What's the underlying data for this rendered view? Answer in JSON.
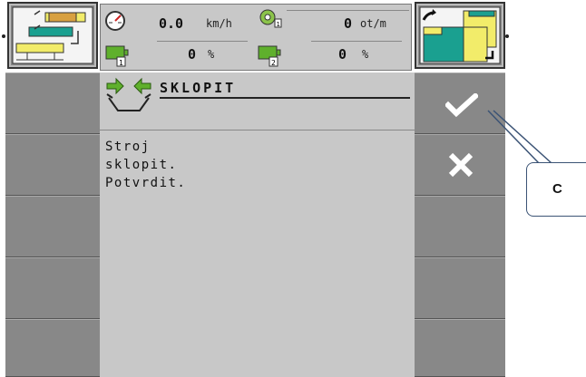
{
  "readouts": {
    "speed_value": "0.0",
    "speed_unit": "km/h",
    "rpm_value": "0",
    "rpm_unit": "ot/m",
    "pto1_value": "0",
    "pto1_unit": "%",
    "pto2_value": "0",
    "pto2_unit": "%"
  },
  "dialog": {
    "title": "SKLOPIT",
    "message": "Stroj\nsklopit.\nPotvrdit."
  },
  "softkeys": {
    "confirm_icon": "checkmark-icon",
    "cancel_icon": "close-icon"
  },
  "annotation": {
    "label": "C"
  },
  "colors": {
    "panel": "#c8c8c8",
    "softkey": "#888888",
    "accent_yellow": "#f2ec6a",
    "accent_teal": "#1aa090",
    "arrow_green": "#5fb02c",
    "callout_border": "#3b5375"
  }
}
